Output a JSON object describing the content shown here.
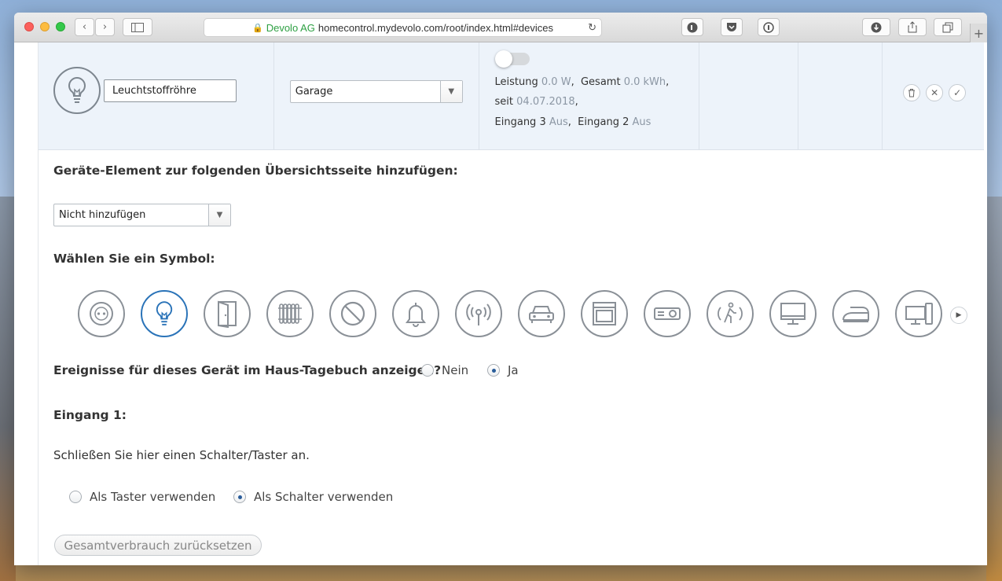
{
  "browser": {
    "org": "Devolo AG",
    "url": "homecontrol.mydevolo.com/root/index.html#devices"
  },
  "device": {
    "name_value": "Leuchtstoffröhre",
    "room": "Garage",
    "stats": {
      "leistung_label": "Leistung",
      "leistung_value": "0.0 W",
      "gesamt_label": "Gesamt",
      "gesamt_value": "0.0 kWh",
      "seit_label": "seit",
      "seit_value": "04.07.2018",
      "eingang3_label": "Eingang 3",
      "eingang3_value": "Aus",
      "eingang2_label": "Eingang 2",
      "eingang2_value": "Aus"
    }
  },
  "overview": {
    "title": "Geräte-Element zur folgenden Übersichtsseite hinzufügen:",
    "selected": "Nicht hinzufügen"
  },
  "symbol": {
    "title": "Wählen Sie ein Symbol:",
    "icons": [
      "socket-icon",
      "bulb-icon",
      "door-icon",
      "radiator-icon",
      "blocked-icon",
      "bell-icon",
      "antenna-icon",
      "car-icon",
      "oven-icon",
      "projector-icon",
      "motion-icon",
      "monitor-icon",
      "iron-icon",
      "devices-icon"
    ]
  },
  "diary": {
    "question": "Ereignisse für dieses Gerät im Haus-Tagebuch anzeigen?",
    "no": "Nein",
    "yes": "Ja"
  },
  "input1": {
    "title": "Eingang 1:",
    "description": "Schließen Sie hier einen Schalter/Taster an.",
    "opt_taster": "Als Taster verwenden",
    "opt_schalter": "Als Schalter verwenden"
  },
  "reset_label": "Gesamtverbrauch zurücksetzen",
  "colors": {
    "accent": "#2a73b8",
    "row_bg": "#edf3fa",
    "ssl": "#2ea043"
  }
}
